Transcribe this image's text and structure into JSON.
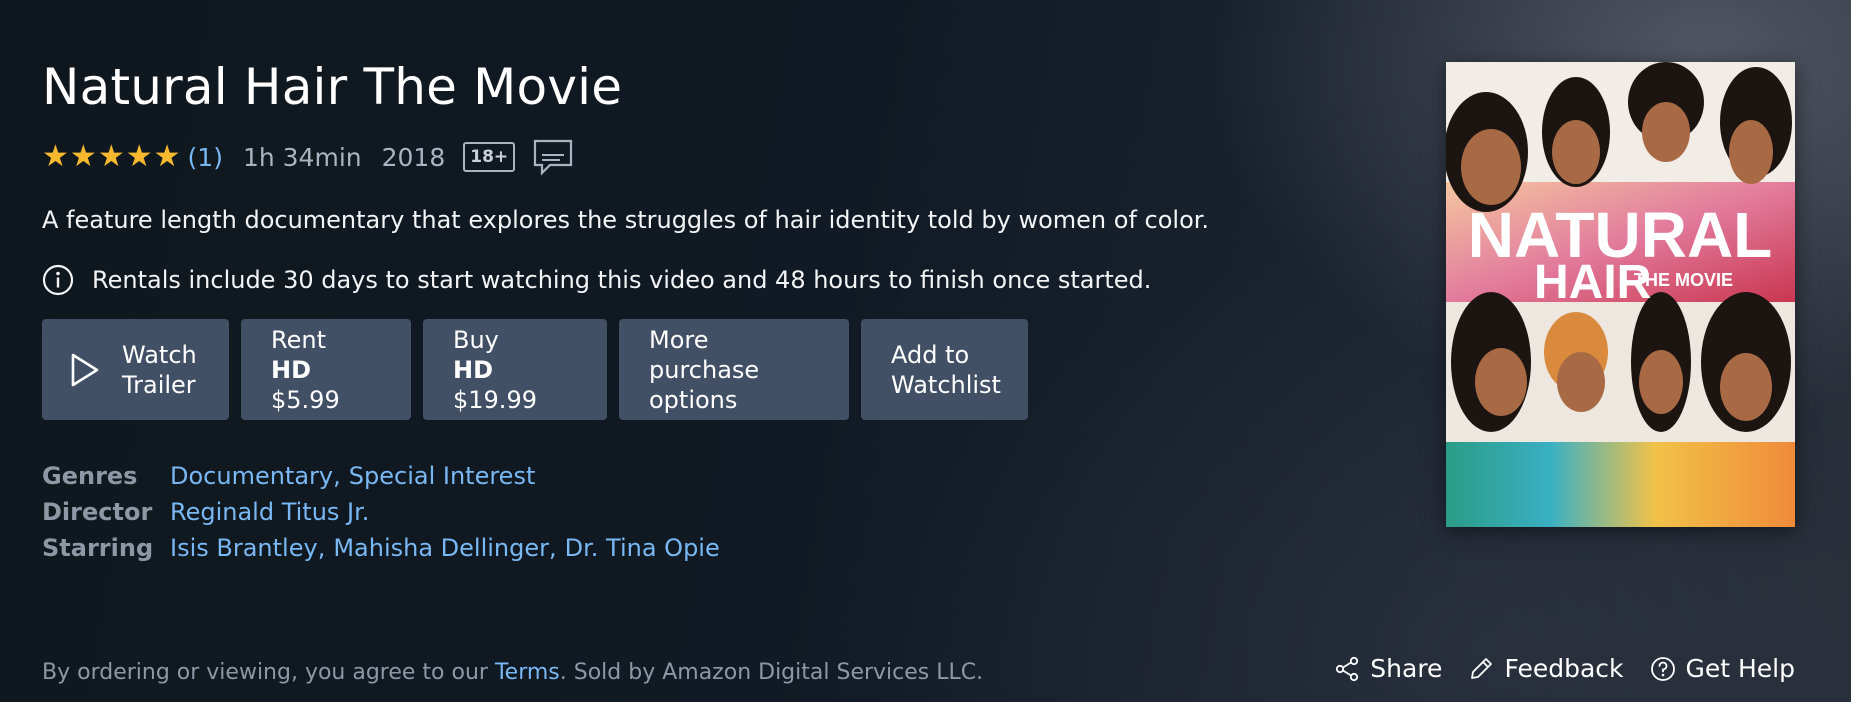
{
  "title": "Natural Hair The Movie",
  "meta": {
    "star_rating": 5,
    "rating_count": "(1)",
    "runtime": "1h 34min",
    "year": "2018",
    "age_rating": "18+",
    "subtitles_icon": "subtitles-icon"
  },
  "synopsis": "A feature length documentary that explores the struggles of hair identity told by women of color.",
  "rental_note": "Rentals include 30 days to start watching this video and 48 hours to finish once started.",
  "buttons": {
    "watch_trailer": [
      "Watch",
      "Trailer"
    ],
    "rent": {
      "line1": "Rent",
      "quality": "HD",
      "price": "$5.99"
    },
    "buy": {
      "line1": "Buy",
      "quality": "HD",
      "price": "$19.99"
    },
    "more": [
      "More purchase",
      "options"
    ],
    "watchlist": [
      "Add to",
      "Watchlist"
    ]
  },
  "details": {
    "genres_label": "Genres",
    "genres": [
      "Documentary",
      "Special Interest"
    ],
    "director_label": "Director",
    "director": "Reginald Titus Jr.",
    "starring_label": "Starring",
    "starring": [
      "Isis Brantley",
      "Mahisha Dellinger",
      "Dr. Tina Opie"
    ]
  },
  "poster": {
    "title_line1": "NATURAL",
    "title_line2": "HAIR",
    "title_line3": "THE MOVIE"
  },
  "footer": {
    "prefix": "By ordering or viewing, you agree to our ",
    "terms": "Terms",
    "suffix": ". Sold by Amazon Digital Services LLC.",
    "share": "Share",
    "feedback": "Feedback",
    "help": "Get Help"
  },
  "colors": {
    "star": "#f5b82e",
    "link": "#79b8f3",
    "button_bg": "#425066"
  }
}
